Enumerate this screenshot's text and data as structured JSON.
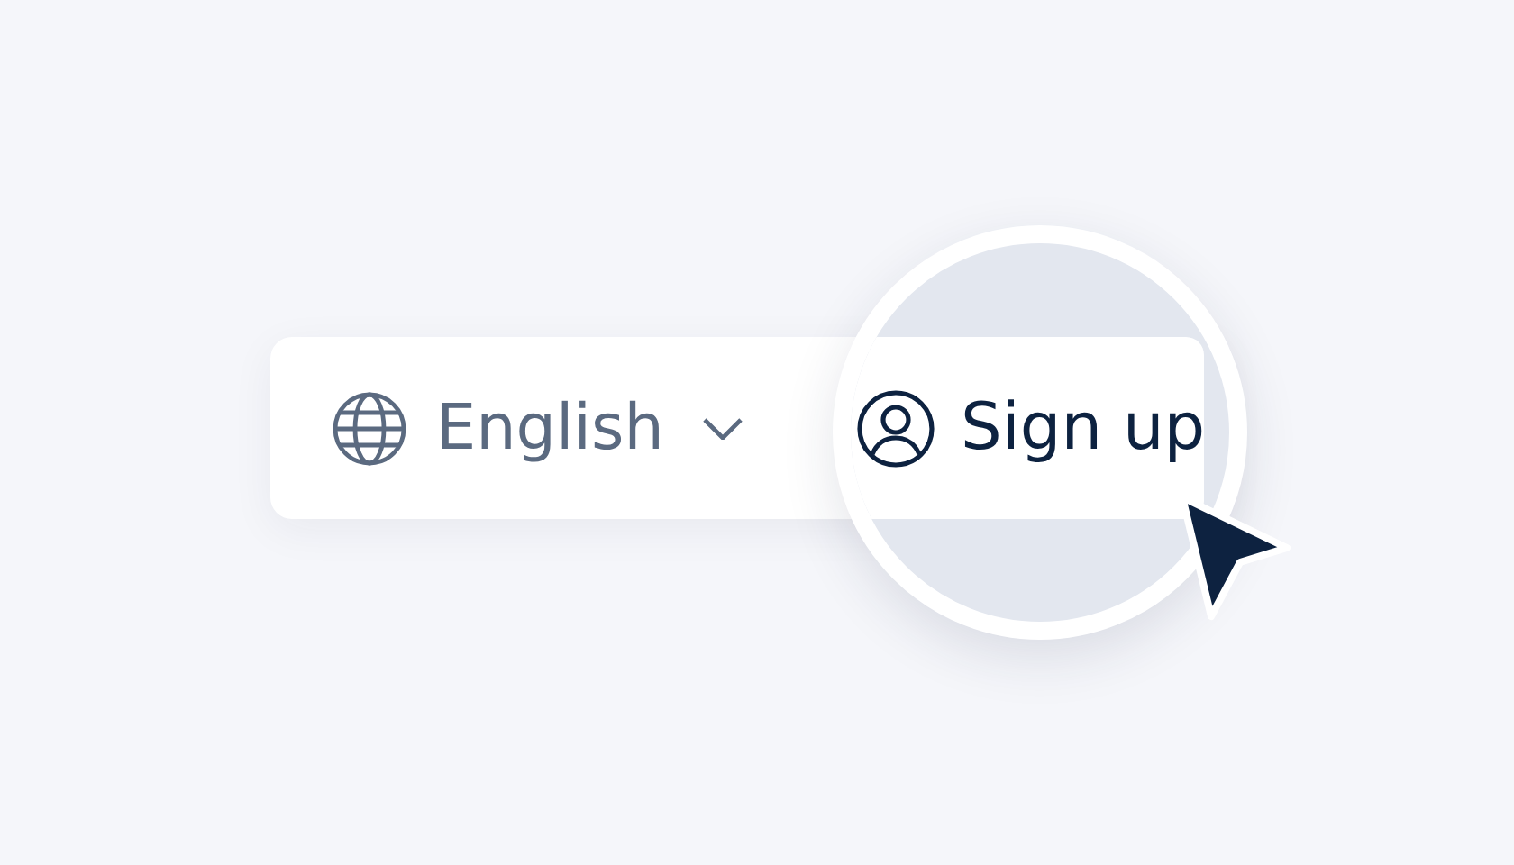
{
  "language_selector": {
    "label": "English"
  },
  "sign_up_button": {
    "label": "Sign up"
  }
}
